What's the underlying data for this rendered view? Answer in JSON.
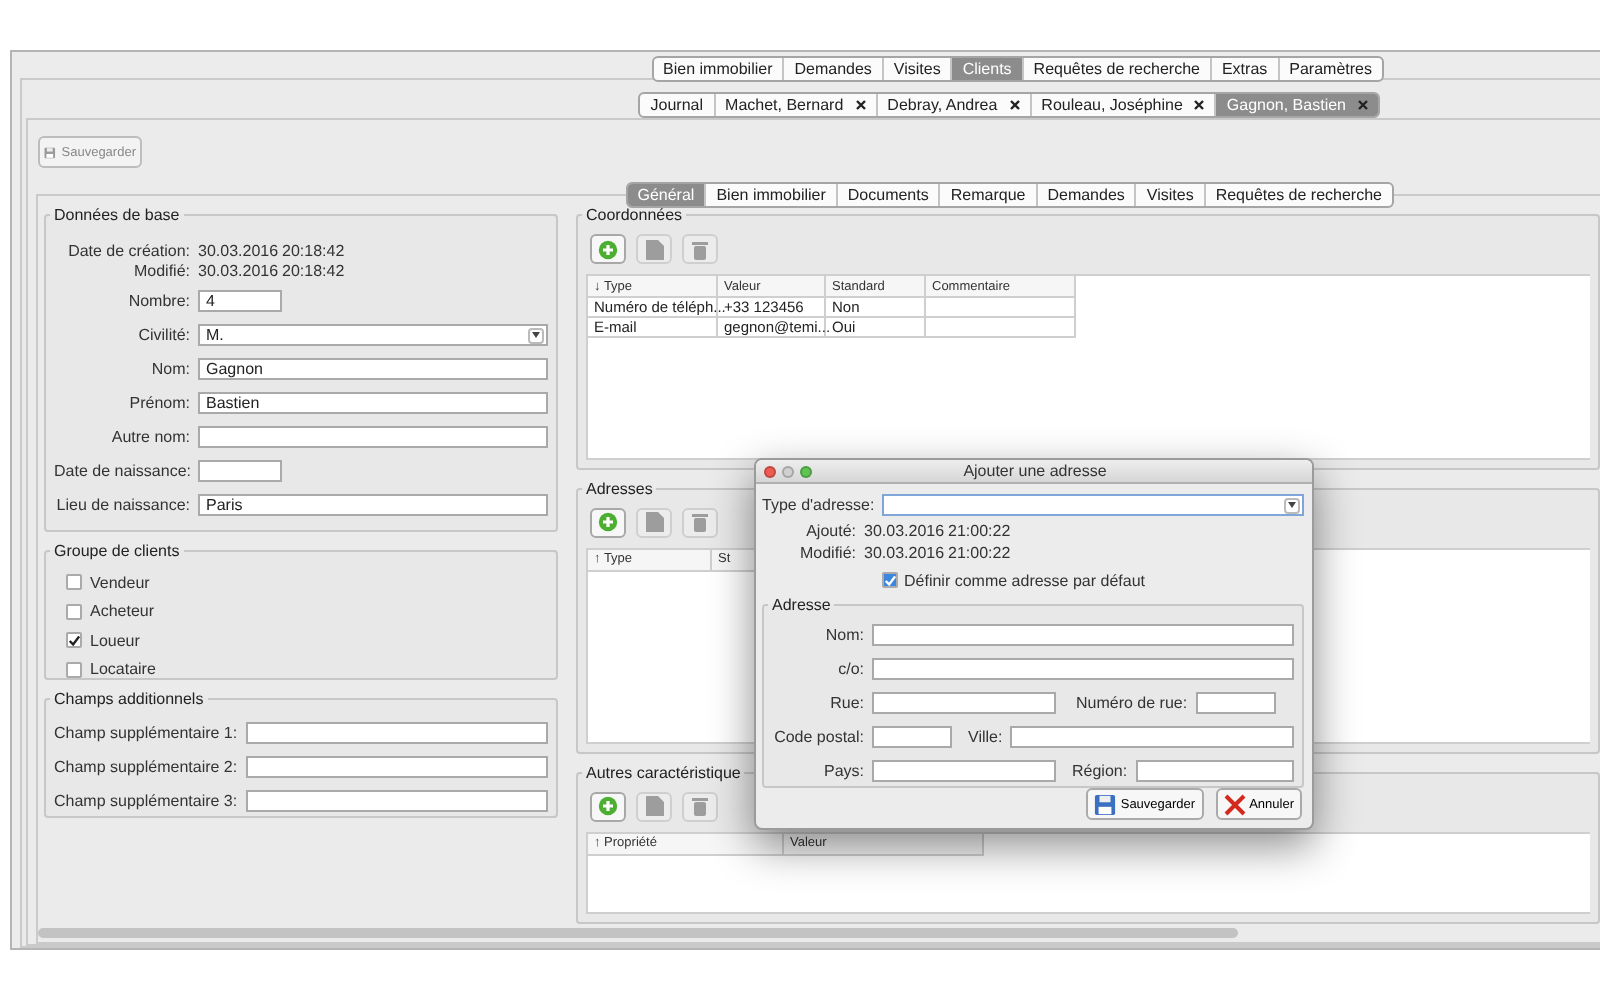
{
  "main_tabs": [
    {
      "label": "Bien immobilier",
      "selected": false
    },
    {
      "label": "Demandes",
      "selected": false
    },
    {
      "label": "Visites",
      "selected": false
    },
    {
      "label": "Clients",
      "selected": true
    },
    {
      "label": "Requêtes de recherche",
      "selected": false
    },
    {
      "label": "Extras",
      "selected": false
    },
    {
      "label": "Paramètres",
      "selected": false
    }
  ],
  "client_tabs": [
    {
      "label": "Journal",
      "selected": false,
      "closable": false
    },
    {
      "label": "Machet, Bernard",
      "selected": false,
      "closable": true
    },
    {
      "label": "Debray, Andrea",
      "selected": false,
      "closable": true
    },
    {
      "label": "Rouleau, Joséphine",
      "selected": false,
      "closable": true
    },
    {
      "label": "Gagnon, Bastien",
      "selected": true,
      "closable": true
    }
  ],
  "save_button": {
    "label": "Sauvegarder",
    "disabled": true
  },
  "section_tabs": [
    {
      "label": "Général",
      "selected": true
    },
    {
      "label": "Bien immobilier",
      "selected": false
    },
    {
      "label": "Documents",
      "selected": false
    },
    {
      "label": "Remarque",
      "selected": false
    },
    {
      "label": "Demandes",
      "selected": false
    },
    {
      "label": "Visites",
      "selected": false
    },
    {
      "label": "Requêtes de recherche",
      "selected": false
    }
  ],
  "basic_data": {
    "title": "Données de base",
    "stamps": [
      {
        "label": "Date de création:",
        "date": "30.03.2016",
        "time": "20:18:42"
      },
      {
        "label": "Modifié:",
        "date": "30.03.2016",
        "time": "20:18:42"
      }
    ],
    "fields": [
      {
        "label": "Nombre:",
        "value": "4",
        "kind": "short"
      },
      {
        "label": "Civilité:",
        "value": "M.",
        "kind": "select"
      },
      {
        "label": "Nom:",
        "value": "Gagnon",
        "kind": "text"
      },
      {
        "label": "Prénom:",
        "value": "Bastien",
        "kind": "text"
      },
      {
        "label": "Autre nom:",
        "kind": "text"
      },
      {
        "label": "Date de naissance:",
        "kind": "short"
      },
      {
        "label": "Lieu de naissance:",
        "value": "Paris",
        "kind": "text"
      }
    ]
  },
  "client_group": {
    "title": "Groupe de clients",
    "options": [
      {
        "label": "Vendeur",
        "checked": false
      },
      {
        "label": "Acheteur",
        "checked": false
      },
      {
        "label": "Loueur",
        "checked": true
      },
      {
        "label": "Locataire",
        "checked": false
      }
    ]
  },
  "additional_fields": {
    "title": "Champs additionnels",
    "fields": [
      {
        "label": "Champ supplémentaire 1:"
      },
      {
        "label": "Champ supplémentaire 2:"
      },
      {
        "label": "Champ supplémentaire 3:"
      }
    ]
  },
  "contacts": {
    "title": "Coordonnées",
    "tools": [
      {
        "kind": "add",
        "disabled": false
      },
      {
        "kind": "edit",
        "disabled": true
      },
      {
        "kind": "delete",
        "disabled": true
      }
    ],
    "columns": [
      "↓ Type",
      "Valeur",
      "Standard",
      "Commentaire"
    ],
    "rows": [
      {
        "type": "Numéro de téléph...",
        "value": "+33 123456",
        "standard": "Non"
      },
      {
        "type": "E-mail",
        "value": "gegnon@temi...",
        "standard": "Oui"
      }
    ]
  },
  "addresses": {
    "title": "Adresses",
    "tools": [
      {
        "kind": "add",
        "disabled": false
      },
      {
        "kind": "edit",
        "disabled": true
      },
      {
        "kind": "delete",
        "disabled": true
      }
    ],
    "columns": [
      "↑ Type",
      "St"
    ]
  },
  "other": {
    "title": "Autres caractéristique",
    "tools": [
      {
        "kind": "add",
        "disabled": false
      },
      {
        "kind": "edit",
        "disabled": true
      },
      {
        "kind": "delete",
        "disabled": true
      }
    ],
    "columns": [
      "↑ Propriété",
      "Valeur"
    ]
  },
  "dialog": {
    "title": "Ajouter une adresse",
    "type_label": "Type d'adresse:",
    "stamps": [
      {
        "label": "Ajouté:",
        "date": "30.03.2016",
        "time": "21:00:22"
      },
      {
        "label": "Modifié:",
        "date": "30.03.2016",
        "time": "21:00:22"
      }
    ],
    "default_checkbox": {
      "label": "Définir comme adresse par défaut",
      "checked": true
    },
    "group_title": "Adresse",
    "rows": [
      [
        {
          "label": "Nom:",
          "kind": "wide"
        }
      ],
      [
        {
          "label": "c/o:",
          "kind": "wide"
        }
      ],
      [
        {
          "label": "Rue:",
          "kind": "medium"
        },
        {
          "label": "Numéro de rue:",
          "kind": "small"
        }
      ],
      [
        {
          "label": "Code postal:",
          "kind": "small"
        },
        {
          "label": "Ville:",
          "kind": "fill"
        }
      ],
      [
        {
          "label": "Pays:",
          "kind": "medium"
        },
        {
          "label": "Région:",
          "kind": "fill"
        }
      ]
    ],
    "buttons": [
      {
        "label": "Sauvegarder",
        "kind": "save"
      },
      {
        "label": "Annuler",
        "kind": "cancel"
      }
    ]
  }
}
